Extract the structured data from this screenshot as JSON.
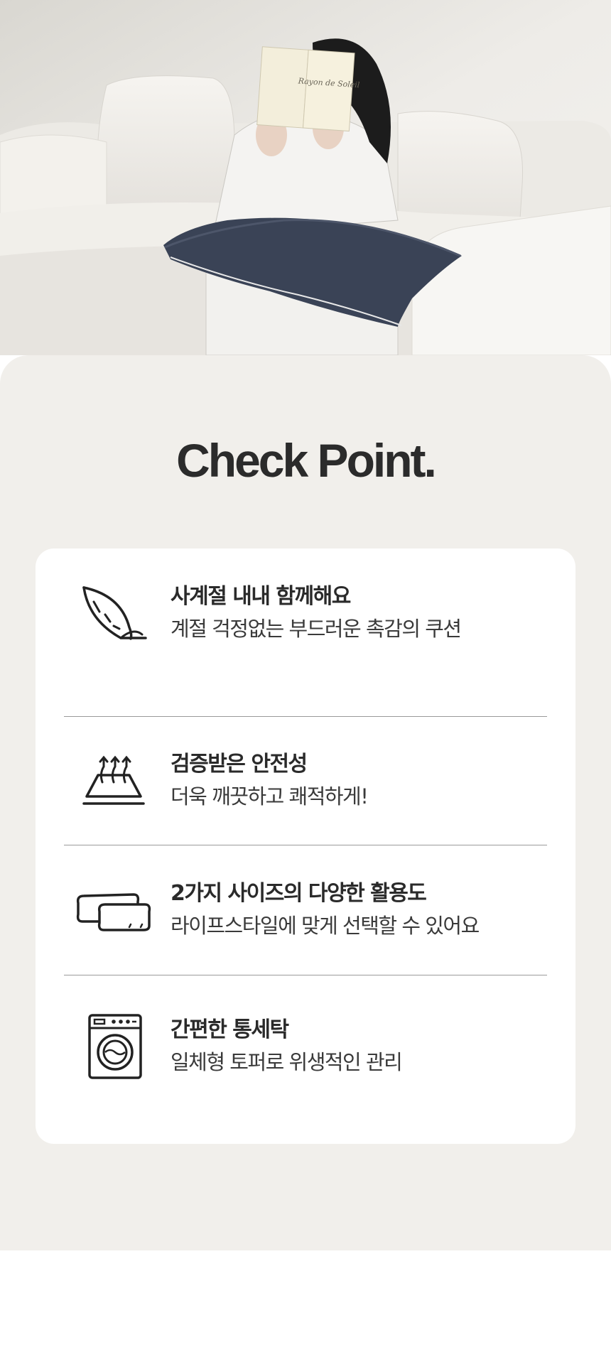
{
  "hero": {
    "photo_alt": "woman on sofa reading a book, holding a navy body pillow",
    "book_cover_text": "Rayon de Soleil"
  },
  "check_point": {
    "title": "Check Point.",
    "items": [
      {
        "icon": "feather-icon",
        "heading": "사계절 내내 함께해요",
        "description": "계절 걱정없는 부드러운 촉감의 쿠션"
      },
      {
        "icon": "breathable-layer-icon",
        "heading": "검증받은 안전성",
        "description": "더욱 깨끗하고 쾌적하게!"
      },
      {
        "icon": "pillows-icon",
        "heading": "2가지 사이즈의 다양한 활용도",
        "description": "라이프스타일에 맞게 선택할 수 있어요"
      },
      {
        "icon": "washing-machine-icon",
        "heading": "간편한 통세탁",
        "description": "일체형 토퍼로 위생적인 관리"
      }
    ]
  },
  "colors": {
    "panel_background": "#f1efeb",
    "card_background": "#ffffff",
    "title_text": "#2b2b2b",
    "pillow_navy": "#3a4356"
  }
}
